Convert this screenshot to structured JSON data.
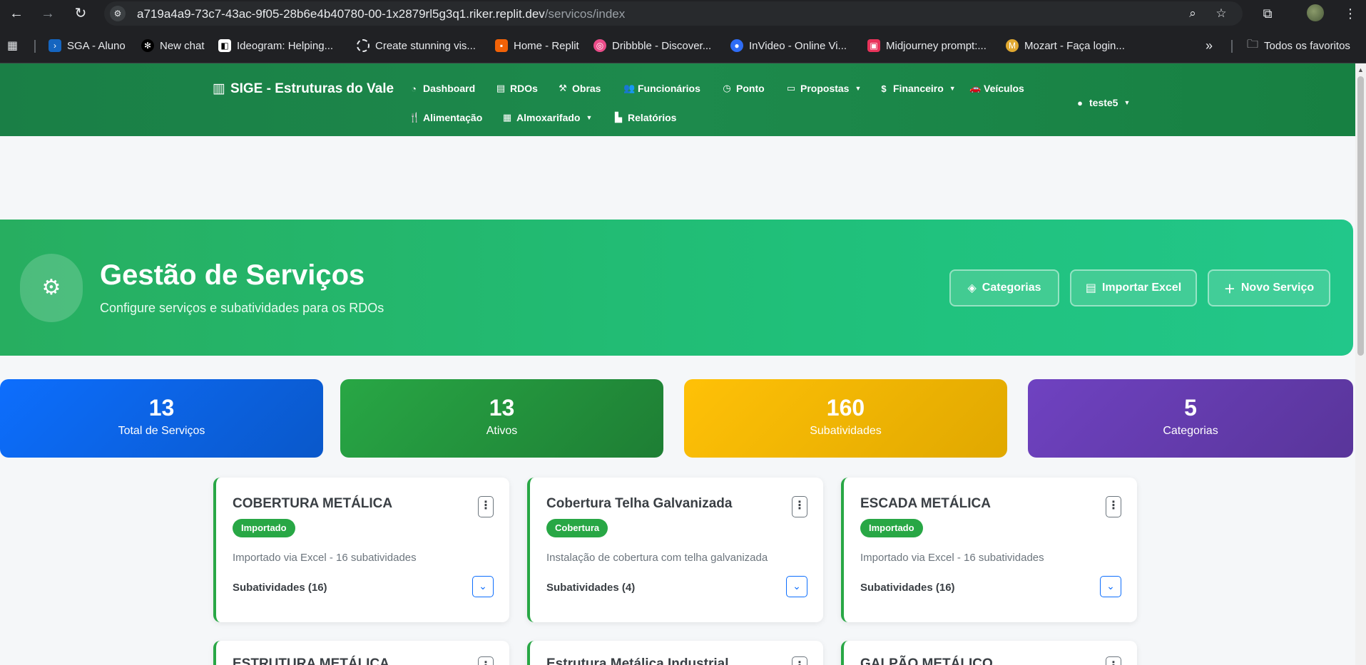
{
  "browser": {
    "url_host": "a719a4a9-73c7-43ac-9f05-28b6e4b40780-00-1x2879rl5g3q1.riker.replit.dev",
    "url_path": "/servicos/index",
    "bookmarks": [
      "SGA - Aluno",
      "New chat",
      "Ideogram: Helping...",
      "Create stunning vis...",
      "Home - Replit",
      "Dribbble - Discover...",
      "InVideo - Online Vi...",
      "Midjourney prompt:...",
      "Mozart - Faça login..."
    ],
    "all_bookmarks": "Todos os favoritos",
    "more": "»"
  },
  "navbar": {
    "brand": "SIGE - Estruturas do Vale",
    "items": [
      "Dashboard",
      "RDOs",
      "Obras",
      "Funcionários",
      "Ponto",
      "Propostas",
      "Financeiro",
      "Veículos",
      "Alimentação",
      "Almoxarifado",
      "Relatórios"
    ],
    "user": "teste5"
  },
  "hero": {
    "title": "Gestão de Serviços",
    "subtitle": "Configure serviços e subatividades para os RDOs",
    "buttons": [
      "Categorias",
      "Importar Excel",
      "Novo Serviço"
    ]
  },
  "stats": [
    {
      "value": "13",
      "label": "Total de Serviços",
      "color": "#0d6efd"
    },
    {
      "value": "13",
      "label": "Ativos",
      "color": "#28a745"
    },
    {
      "value": "160",
      "label": "Subatividades",
      "color": "#ffc107"
    },
    {
      "value": "5",
      "label": "Categorias",
      "color": "#6f42c1"
    }
  ],
  "services": [
    {
      "title": "COBERTURA METÁLICA",
      "badge": "Importado",
      "description": "Importado via Excel - 16 subatividades",
      "subatividades": "Subatividades (16)"
    },
    {
      "title": "Cobertura Telha Galvanizada",
      "badge": "Cobertura",
      "description": "Instalação de cobertura com telha galvanizada",
      "subatividades": "Subatividades (4)"
    },
    {
      "title": "ESCADA METÁLICA",
      "badge": "Importado",
      "description": "Importado via Excel - 16 subatividades",
      "subatividades": "Subatividades (16)"
    }
  ],
  "services_row2": [
    "ESTRUTURA METÁLICA",
    "Estrutura Metálica Industrial",
    "GALPÃO METÁLICO"
  ]
}
